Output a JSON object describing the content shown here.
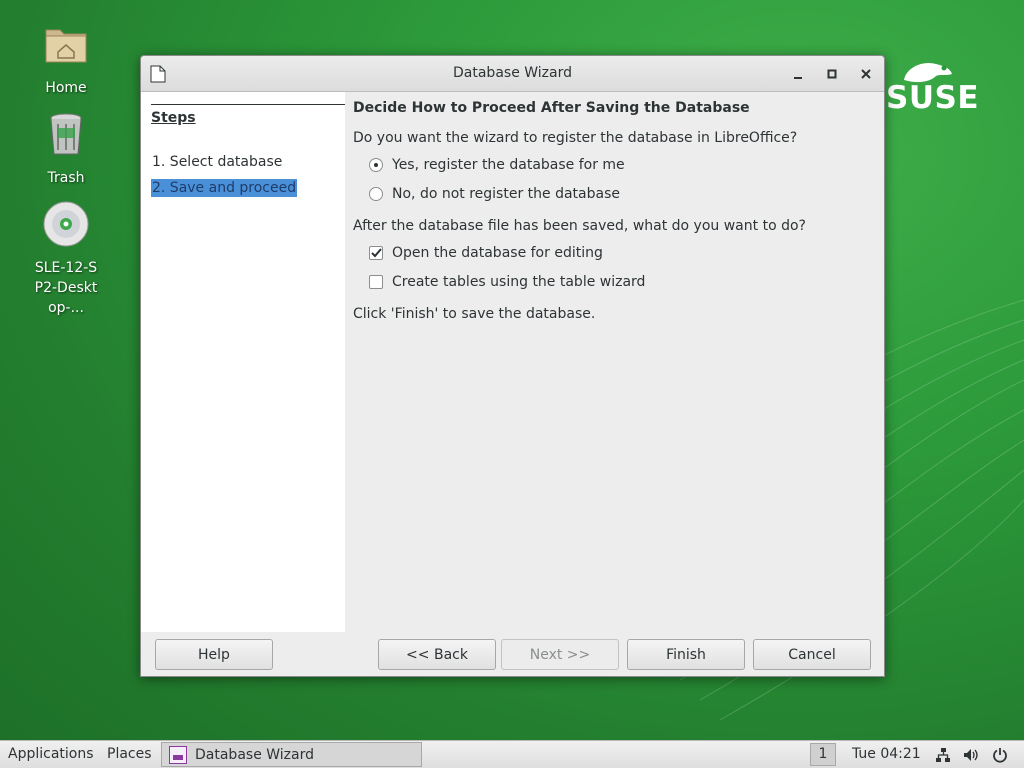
{
  "desktop": {
    "icons": [
      {
        "label": "Home",
        "icon": "home-folder-icon"
      },
      {
        "label": "Trash",
        "icon": "trash-icon"
      },
      {
        "label": "SLE-12-SP2-Desktop-...",
        "icon": "cd-disc-icon"
      }
    ],
    "brand_logo_text": "SUSE",
    "background_color": "#2c9a3a"
  },
  "window": {
    "title": "Database Wizard",
    "steps": {
      "title": "Steps",
      "items": [
        {
          "label": "1. Select database",
          "active": false
        },
        {
          "label": "2. Save and proceed",
          "active": true
        }
      ]
    },
    "content": {
      "heading": "Decide How to Proceed After Saving the Database",
      "register_question": "Do you want the wizard to register the database in LibreOffice?",
      "register_yes": "Yes, register the database for me",
      "register_no": "No, do not register the database",
      "register_selected": "yes",
      "after_save_question": "After the database file has been saved, what do you want to do?",
      "open_for_editing": "Open the database for editing",
      "open_for_editing_checked": true,
      "create_tables": "Create tables using the table wizard",
      "create_tables_checked": false,
      "finish_hint": "Click 'Finish' to save the database."
    },
    "buttons": {
      "help": "Help",
      "back": "<< Back",
      "next": "Next >>",
      "next_enabled": false,
      "finish": "Finish",
      "cancel": "Cancel"
    }
  },
  "taskbar": {
    "applications": "Applications",
    "places": "Places",
    "task_label": "Database Wizard",
    "workspace": "1",
    "clock": "Tue 04:21",
    "tray_icons": [
      "network-icon",
      "volume-icon",
      "power-icon"
    ]
  },
  "colors": {
    "selection": "#4a90d9",
    "window_bg": "#ededed"
  }
}
